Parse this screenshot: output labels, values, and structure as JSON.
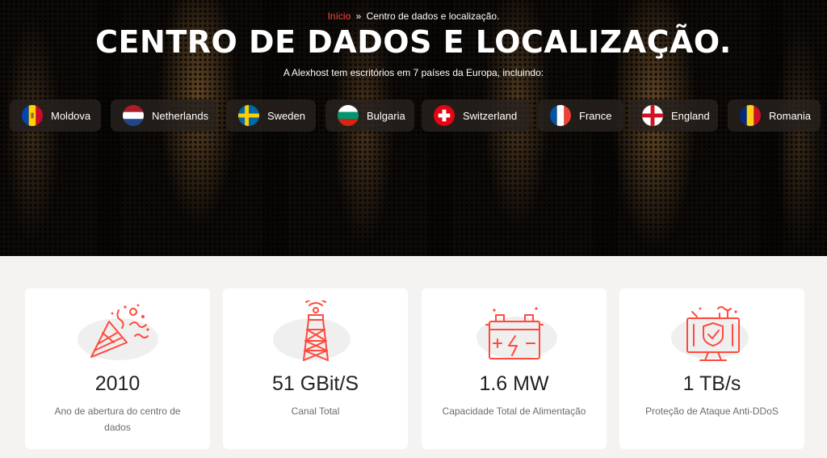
{
  "breadcrumb": {
    "home": "Início",
    "separator": "»",
    "current": "Centro de dados e localização."
  },
  "hero": {
    "title": "CENTRO DE DADOS E LOCALIZAÇÃO.",
    "subtitle": "A Alexhost tem escritórios em 7 países da Europa, incluindo:"
  },
  "countries": [
    {
      "name": "Moldova",
      "flag_icon": "moldova-flag-icon"
    },
    {
      "name": "Netherlands",
      "flag_icon": "netherlands-flag-icon"
    },
    {
      "name": "Sweden",
      "flag_icon": "sweden-flag-icon"
    },
    {
      "name": "Bulgaria",
      "flag_icon": "bulgaria-flag-icon"
    },
    {
      "name": "Switzerland",
      "flag_icon": "switzerland-flag-icon"
    },
    {
      "name": "France",
      "flag_icon": "france-flag-icon"
    },
    {
      "name": "England",
      "flag_icon": "england-flag-icon"
    },
    {
      "name": "Romania",
      "flag_icon": "romania-flag-icon"
    }
  ],
  "stats": [
    {
      "value": "2010",
      "label": "Ano de abertura do centro de dados",
      "icon": "party-popper-icon"
    },
    {
      "value": "51 GBit/S",
      "label": "Canal Total",
      "icon": "radio-tower-icon"
    },
    {
      "value": "1.6 MW",
      "label": "Capacidade Total de Alimentação",
      "icon": "battery-icon"
    },
    {
      "value": "1 TB/s",
      "label": "Proteção de Ataque Anti-DDoS",
      "icon": "shield-monitor-icon"
    }
  ],
  "colors": {
    "accent": "#ff4a3d",
    "hero_background": "#0d0a08",
    "page_background": "#f4f3f1",
    "card_background": "#ffffff",
    "pill_background": "#28221e"
  }
}
